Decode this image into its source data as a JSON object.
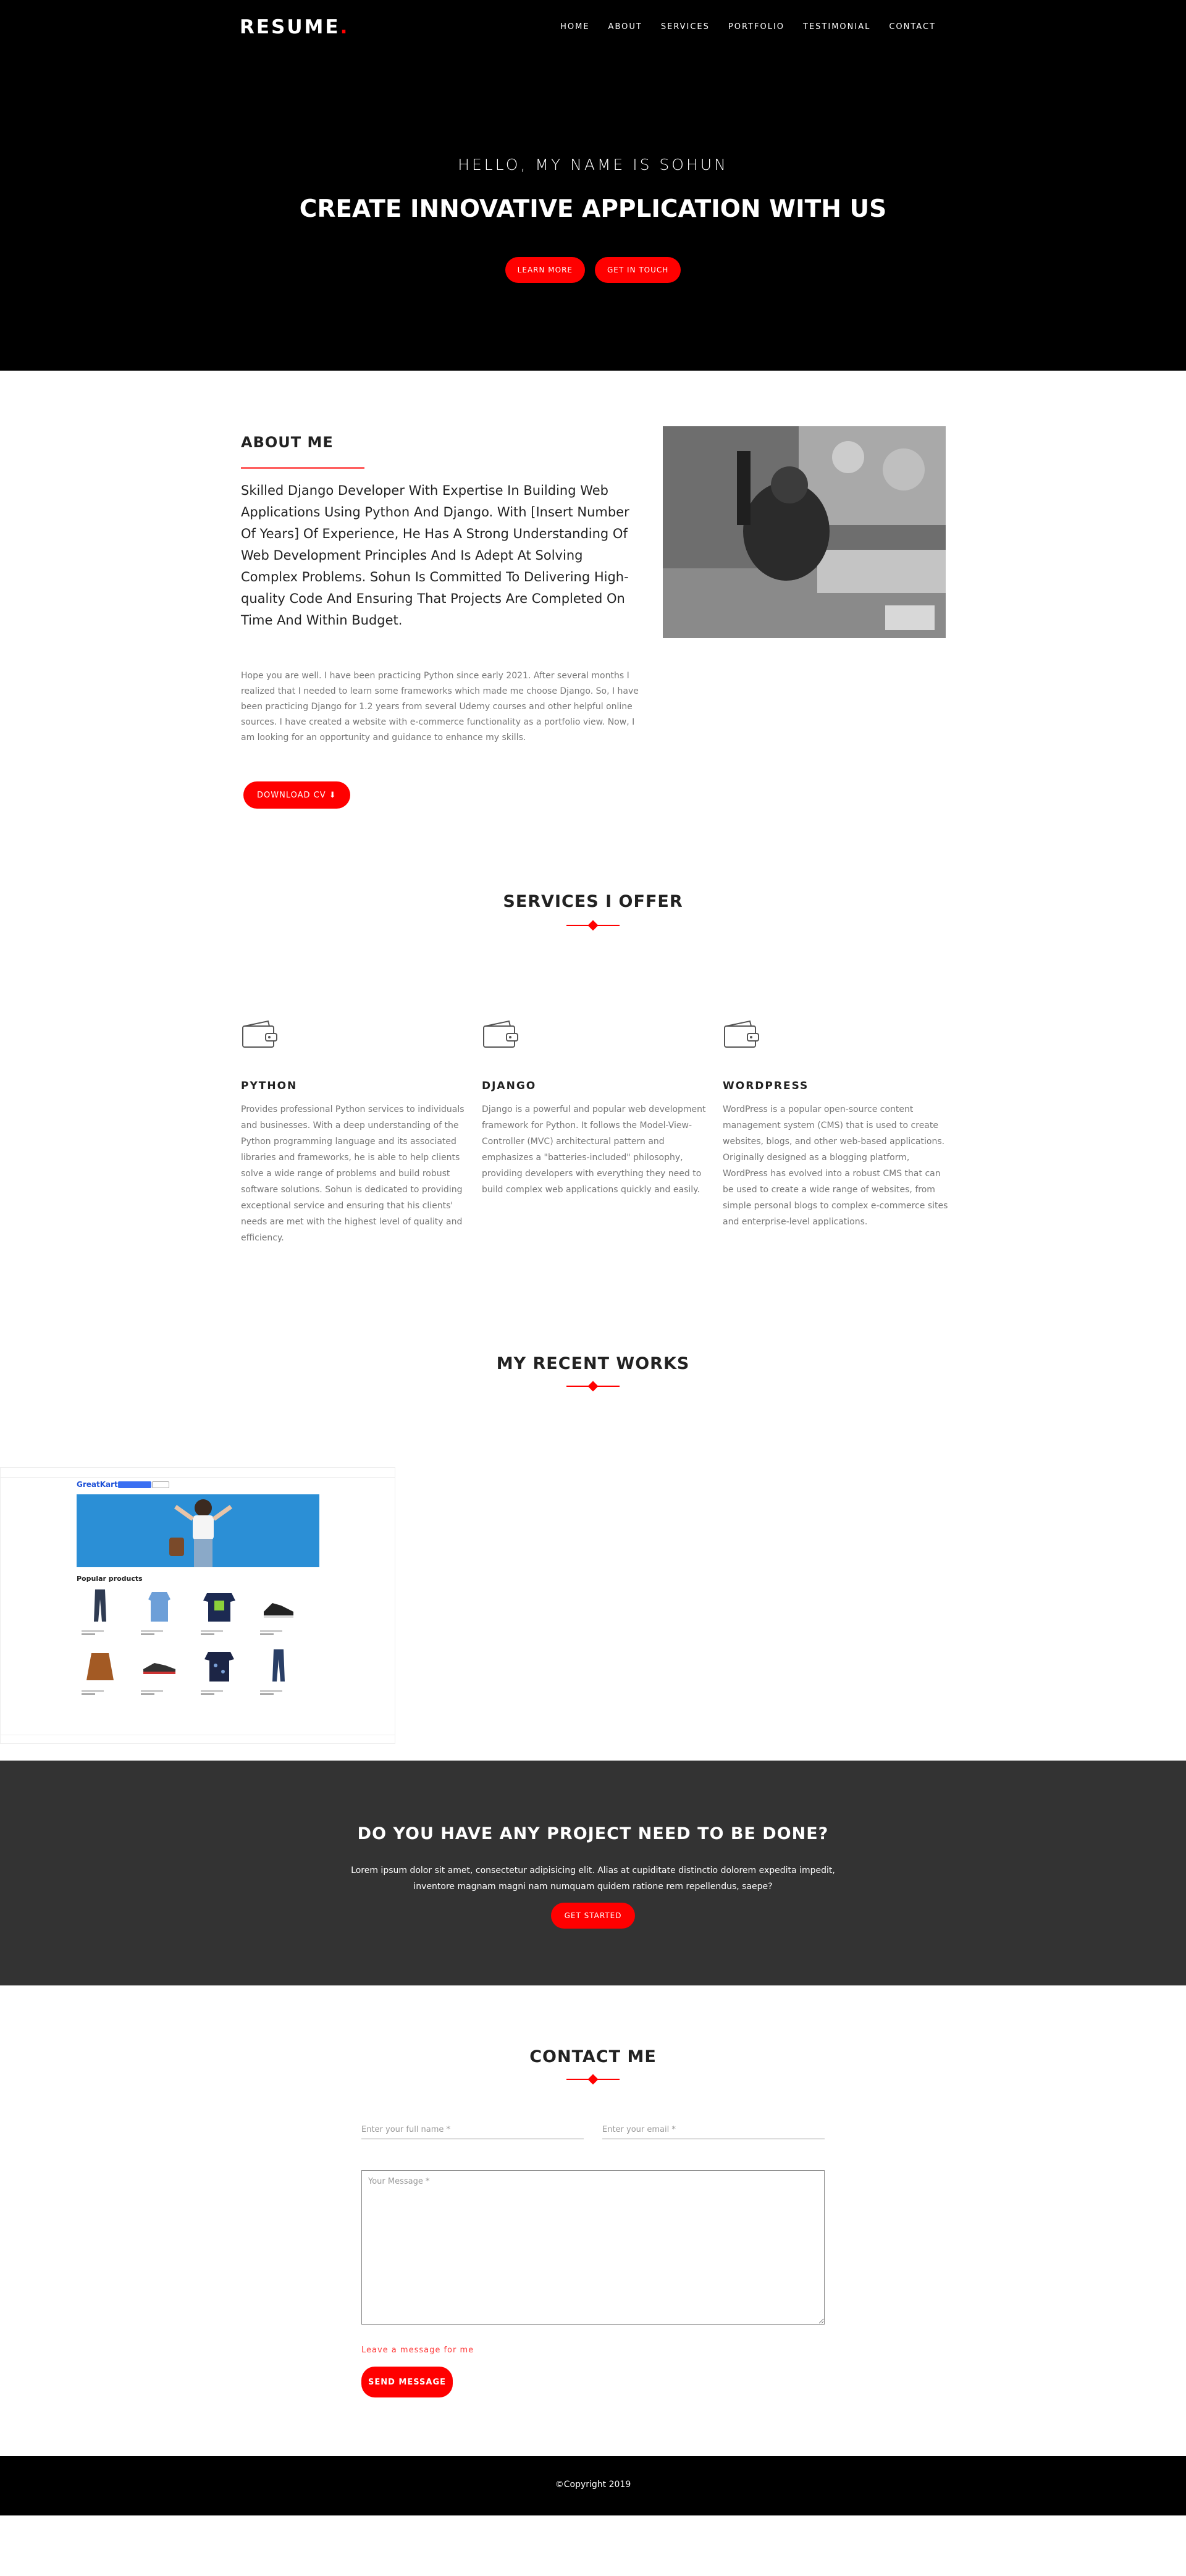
{
  "brand": {
    "logo": "RESUME",
    "dot": ".",
    "accent": "#ff0000"
  },
  "nav": {
    "items": [
      "HOME",
      "ABOUT",
      "SERVICES",
      "PORTFOLIO",
      "TESTIMONIAL",
      "CONTACT"
    ]
  },
  "hero": {
    "subtitle": "HELLO, MY NAME IS SOHUN",
    "title": "CREATE INNOVATIVE APPLICATION WITH US",
    "learn_more": "LEARN MORE",
    "get_in_touch": "GET IN TOUCH"
  },
  "about": {
    "heading": "ABOUT ME",
    "lead": "Skilled Django Developer With Expertise In Building Web Applications Using Python And Django. With [Insert Number Of Years] Of Experience, He Has A Strong Understanding Of Web Development Principles And Is Adept At Solving Complex Problems. Sohun Is Committed To Delivering High-quality Code And Ensuring That Projects Are Completed On Time And Within Budget.",
    "text": "Hope you are well. I have been practicing Python since early 2021. After several months I realized that I needed to learn some frameworks which made me choose Django. So, I have been practicing Django for 1.2 years from several Udemy courses and other helpful online sources. I have created a website with e-commerce functionality as a portfolio view. Now, I am looking for an opportunity and guidance to enhance my skills.",
    "download": "DOWNLOAD CV"
  },
  "services": {
    "heading": "SERVICES I OFFER",
    "items": [
      {
        "name": "PYTHON",
        "desc": "Provides professional Python services to individuals and businesses. With a deep understanding of the Python programming language and its associated libraries and frameworks, he is able to help clients solve a wide range of problems and build robust software solutions. Sohun is dedicated to providing exceptional service and ensuring that his clients' needs are met with the highest level of quality and efficiency.",
        "icon": "wallet-icon"
      },
      {
        "name": "DJANGO",
        "desc": "Django is a powerful and popular web development framework for Python. It follows the Model-View-Controller (MVC) architectural pattern and emphasizes a \"batteries-included\" philosophy, providing developers with everything they need to build complex web applications quickly and easily.",
        "icon": "wallet-icon"
      },
      {
        "name": "WORDPRESS",
        "desc": "WordPress is a popular open-source content management system (CMS) that is used to create websites, blogs, and other web-based applications. Originally designed as a blogging platform, WordPress has evolved into a robust CMS that can be used to create a wide range of websites, from simple personal blogs to complex e-commerce sites and enterprise-level applications.",
        "icon": "wallet-icon"
      }
    ]
  },
  "works": {
    "heading": "MY RECENT WORKS",
    "shop_logo": "GreatKart",
    "shop_section": "Popular products"
  },
  "cta": {
    "heading": "DO YOU HAVE ANY PROJECT NEED TO BE DONE?",
    "text": "Lorem ipsum dolor sit amet, consectetur adipisicing elit. Alias at cupiditate distinctio dolorem expedita impedit, inventore magnam magni nam numquam quidem ratione rem repellendus, saepe?",
    "button": "GET STARTED"
  },
  "contact": {
    "heading": "CONTACT ME",
    "name_placeholder": "Enter your full name *",
    "email_placeholder": "Enter your email *",
    "message_placeholder": "Your Message *",
    "hint": "Leave a message for me",
    "send": "SEND MESSAGE"
  },
  "footer": {
    "copyright": "©Copyright 2019"
  }
}
